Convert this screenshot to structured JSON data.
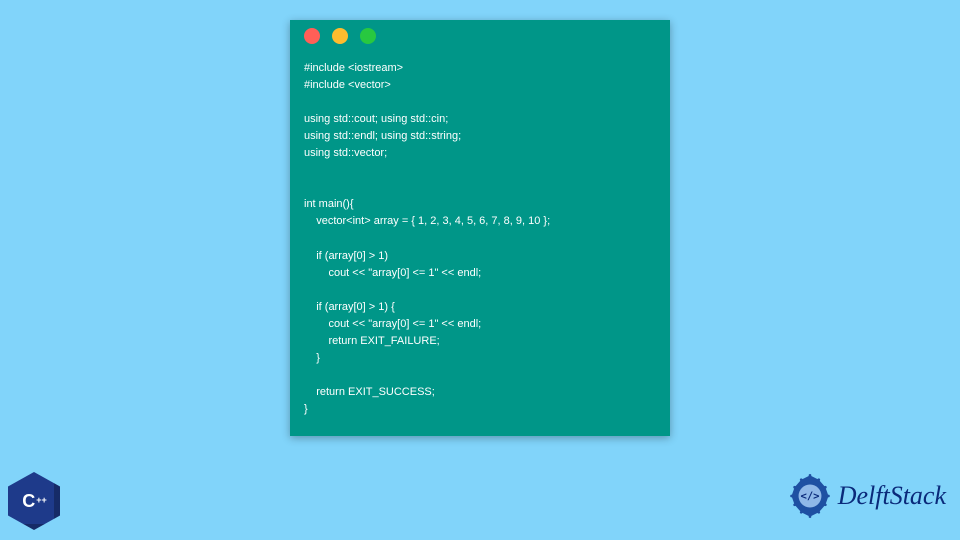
{
  "code": {
    "l1": "#include <iostream>",
    "l2": "#include <vector>",
    "l3": "",
    "l4": "using std::cout; using std::cin;",
    "l5": "using std::endl; using std::string;",
    "l6": "using std::vector;",
    "l7": "",
    "l8": "",
    "l9": "int main(){",
    "l10": "    vector<int> array = { 1, 2, 3, 4, 5, 6, 7, 8, 9, 10 };",
    "l11": "",
    "l12": "    if (array[0] > 1)",
    "l13": "        cout << \"array[0] <= 1\" << endl;",
    "l14": "",
    "l15": "    if (array[0] > 1) {",
    "l16": "        cout << \"array[0] <= 1\" << endl;",
    "l17": "        return EXIT_FAILURE;",
    "l18": "    }",
    "l19": "",
    "l20": "    return EXIT_SUCCESS;",
    "l21": "}"
  },
  "logos": {
    "cpp_letter": "C",
    "cpp_plus": "++",
    "delft_name": "DelftStack"
  }
}
